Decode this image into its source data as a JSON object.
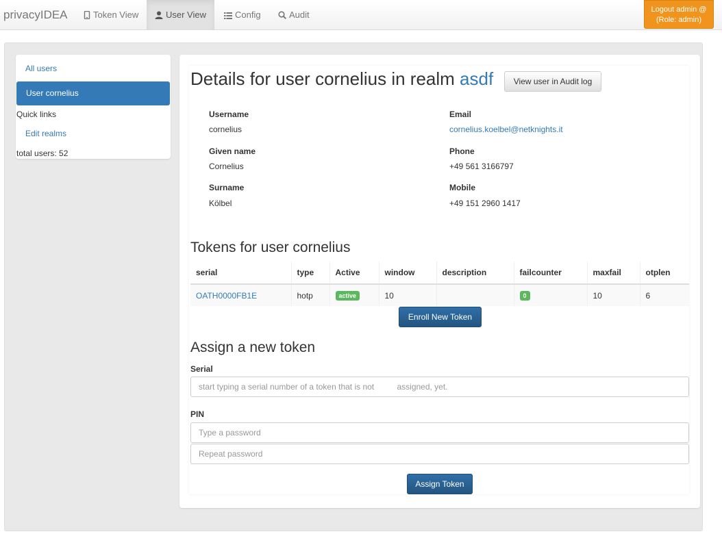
{
  "navbar": {
    "brand": "privacyIDEA",
    "items": [
      {
        "label": "Token View",
        "icon": "phone-icon"
      },
      {
        "label": "User View",
        "icon": "user-icon"
      },
      {
        "label": "Config",
        "icon": "list-icon"
      },
      {
        "label": "Audit",
        "icon": "search-icon"
      }
    ],
    "logout_line1": "Logout admin @",
    "logout_line2": "(Role: admin)",
    "logout_color": "#f0941d"
  },
  "sidebar": {
    "all_users": "All users",
    "active_user": "User cornelius",
    "quick_links": "Quick links",
    "edit_realms": "Edit realms",
    "total_users": "total users: 52"
  },
  "details": {
    "title_prefix": "Details for user cornelius in realm",
    "realm": "asdf",
    "audit_button": "View user in Audit log",
    "fields": [
      {
        "label": "Username",
        "value": "cornelius"
      },
      {
        "label": "Email",
        "value": "cornelius.koelbel@netknights.it"
      },
      {
        "label": "Given name",
        "value": "Cornelius"
      },
      {
        "label": "Phone",
        "value": "+49 561 3166797"
      },
      {
        "label": "Surname",
        "value": "Kölbel"
      },
      {
        "label": "Mobile",
        "value": "+49 151 2960 1417"
      }
    ]
  },
  "tokens": {
    "heading": "Tokens for user cornelius",
    "columns": [
      "serial",
      "type",
      "Active",
      "window",
      "description",
      "failcounter",
      "maxfail",
      "otplen"
    ],
    "rows": [
      {
        "serial": "OATH0000FB1E",
        "type": "hotp",
        "active": "active",
        "window": "10",
        "description": "",
        "failcounter": "0",
        "maxfail": "10",
        "otplen": "6"
      }
    ],
    "enroll_button": "Enroll New Token"
  },
  "assign": {
    "heading": "Assign a new token",
    "serial_label": "Serial",
    "serial_placeholder": "start typing a serial number of a token that is not          assigned, yet.",
    "pin_label": "PIN",
    "pin_placeholder": "Type a password",
    "repeat_placeholder": "Repeat password",
    "assign_button": "Assign Token"
  }
}
